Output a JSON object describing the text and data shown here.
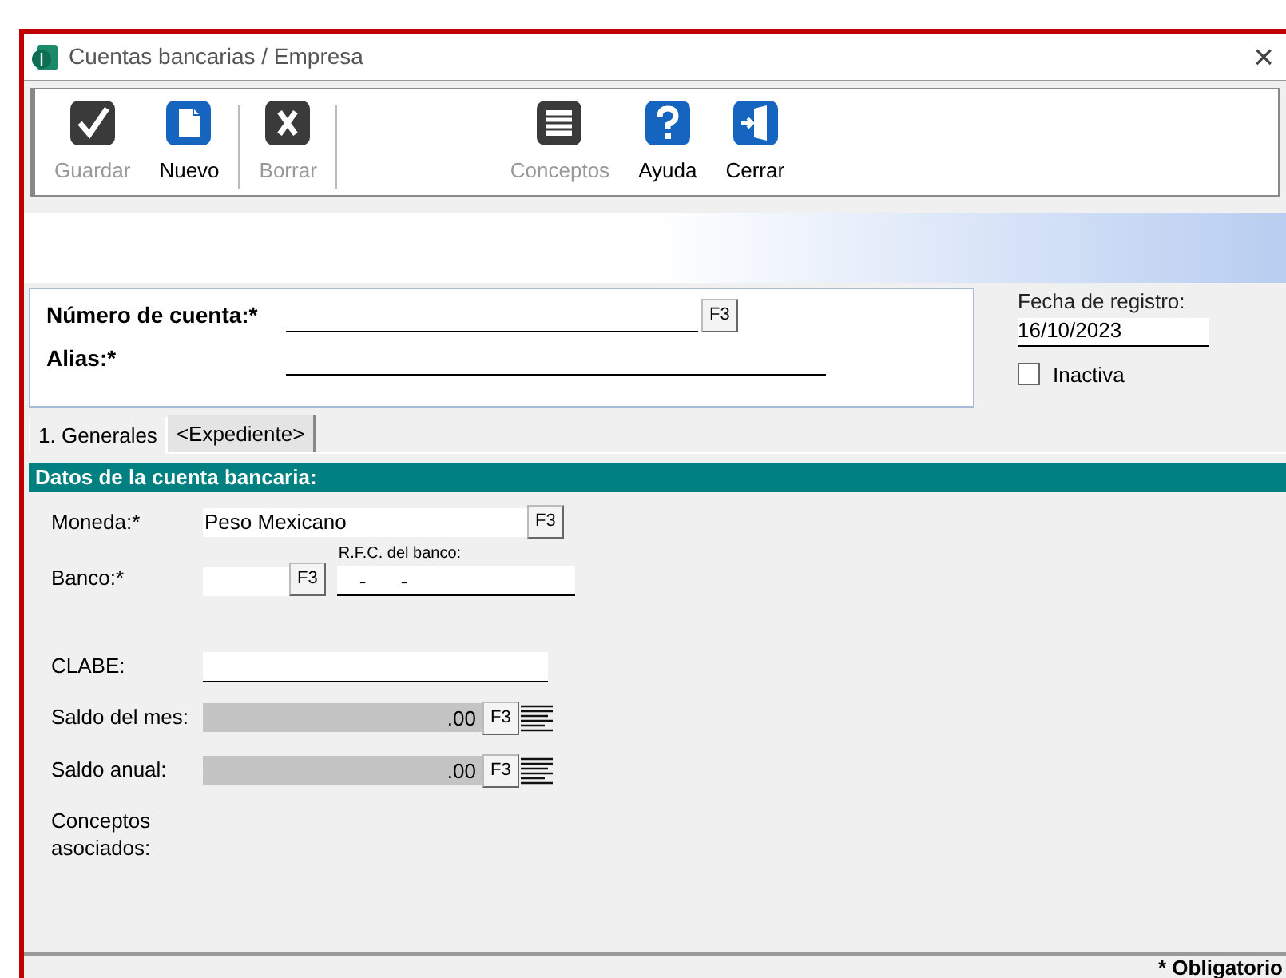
{
  "window": {
    "title": "Cuentas bancarias / Empresa",
    "close": "×"
  },
  "toolbar": [
    {
      "kind": "save",
      "label": "Guardar",
      "disabled": true
    },
    {
      "kind": "new",
      "label": "Nuevo",
      "disabled": false
    },
    {
      "kind": "delete",
      "label": "Borrar",
      "disabled": true
    },
    {
      "kind": "concepts",
      "label": "Conceptos",
      "disabled": true
    },
    {
      "kind": "help",
      "label": "Ayuda",
      "disabled": false
    },
    {
      "kind": "close",
      "label": "Cerrar",
      "disabled": false
    }
  ],
  "header_form": {
    "account_number": {
      "label": "Número de cuenta:*",
      "button": "F3"
    },
    "alias": {
      "label": "Alias:*"
    }
  },
  "registration_date": {
    "label": "Fecha de registro:",
    "value": "16/10/2023"
  },
  "inactive": {
    "label": "Inactiva",
    "checked": false
  },
  "tabs": [
    {
      "label": "1. Generales",
      "selected": true
    },
    {
      "label": "<Expediente>",
      "selected": false
    }
  ],
  "section_title": "Datos de la cuenta bancaria:",
  "fields": {
    "currency": {
      "label": "Moneda:*",
      "value": "Peso Mexicano",
      "button": "F3"
    },
    "bank": {
      "label": "Banco:*",
      "button": "F3",
      "rfc_label": "R.F.C. del banco:",
      "rfc_value": "-      -"
    },
    "clabe": {
      "label": "CLABE:"
    },
    "month_balance": {
      "label": "Saldo del mes:",
      "value": ".00",
      "button": "F3"
    },
    "year_balance": {
      "label": "Saldo anual:",
      "value": ".00",
      "button": "F3"
    },
    "concepts": {
      "label": "Conceptos asociados:"
    }
  },
  "status_bar": {
    "text": "* Obligatorio"
  }
}
